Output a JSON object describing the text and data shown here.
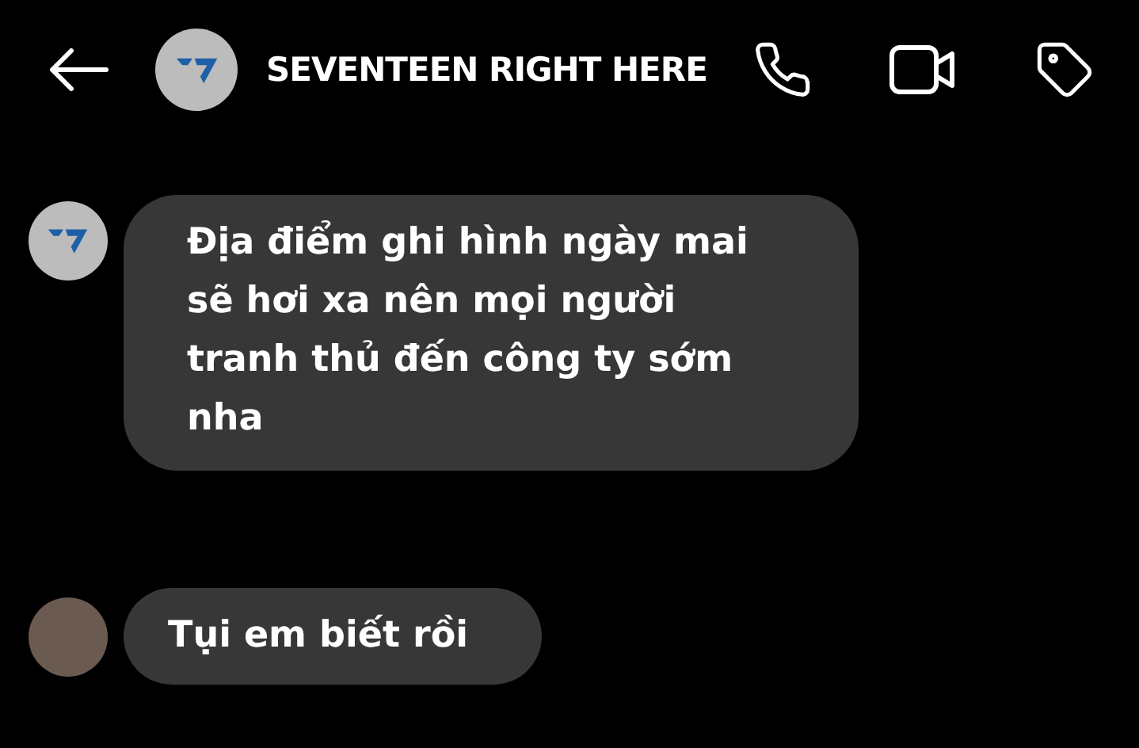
{
  "header": {
    "title": "SEVENTEEN RIGHT HERE",
    "avatar": {
      "kind": "logo"
    }
  },
  "messages": [
    {
      "avatar": {
        "kind": "logo"
      },
      "text": "Địa điểm ghi hình ngày mai\nsẽ hơi xa nên mọi người\ntranh thủ đến công ty sớm\nnha"
    },
    {
      "avatar": {
        "kind": "photo"
      },
      "text": "Tụi em biết rồi"
    }
  ]
}
